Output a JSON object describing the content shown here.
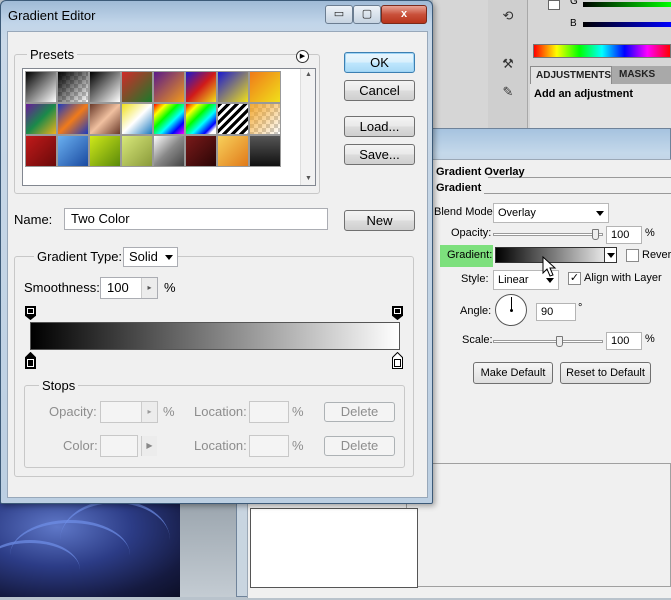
{
  "gradient_editor": {
    "title": "Gradient Editor",
    "caption_buttons": {
      "minimize": "▭",
      "maximize": "▢",
      "close": "x"
    },
    "presets_legend": "Presets",
    "buttons": {
      "ok": "OK",
      "cancel": "Cancel",
      "load": "Load...",
      "save": "Save...",
      "new": "New"
    },
    "name_label": "Name:",
    "name_value": "Two Color",
    "gradient_type_label": "Gradient Type:",
    "gradient_type_value": "Solid",
    "smoothness_label": "Smoothness:",
    "smoothness_value": "100",
    "smoothness_unit": "%",
    "stops": {
      "legend": "Stops",
      "opacity_label": "Opacity:",
      "opacity_unit": "%",
      "location_label": "Location:",
      "location_unit": "%",
      "color_label": "Color:",
      "delete_label": "Delete"
    },
    "gradient_colors": [
      "#000000",
      "#ffffff"
    ]
  },
  "layer_style": {
    "section_title": "Gradient Overlay",
    "subsection_title": "Gradient",
    "blend_mode_label": "Blend Mode:",
    "blend_mode_value": "Overlay",
    "opacity_label": "Opacity:",
    "opacity_value": "100",
    "opacity_unit": "%",
    "gradient_label": "Gradient:",
    "reverse_label": "Reverse",
    "style_label": "Style:",
    "style_value": "Linear",
    "align_label": "Align with Layer",
    "align_checked": "✓",
    "angle_label": "Angle:",
    "angle_value": "90",
    "angle_unit": "°",
    "scale_label": "Scale:",
    "scale_value": "100",
    "scale_unit": "%",
    "make_default": "Make Default",
    "reset_default": "Reset to Default"
  },
  "photoshop": {
    "adjustments_tab": "ADJUSTMENTS",
    "masks_tab": "MASKS",
    "adjustments_title": "Add an adjustment",
    "channel_g": "G",
    "channel_b": "B"
  }
}
